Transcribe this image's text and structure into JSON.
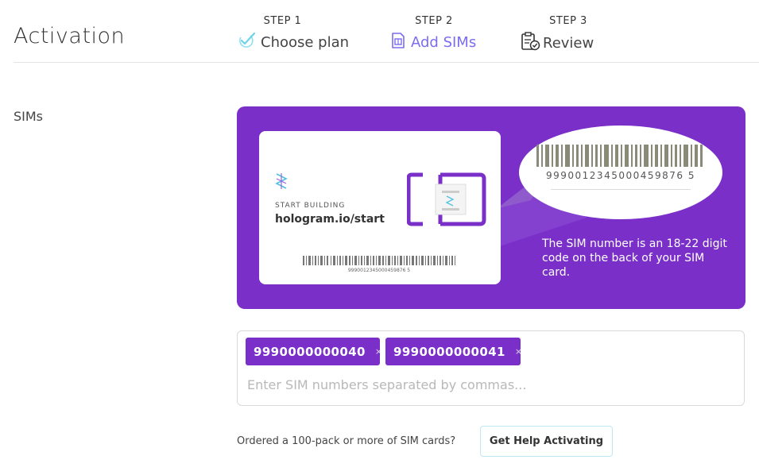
{
  "header": {
    "title": "Activation",
    "steps": [
      {
        "number": "STEP 1",
        "label": "Choose plan",
        "icon": "checkmark-icon",
        "state": "done"
      },
      {
        "number": "STEP 2",
        "label": "Add SIMs",
        "icon": "sim-card-icon",
        "state": "active"
      },
      {
        "number": "STEP 3",
        "label": "Review",
        "icon": "clipboard-check-icon",
        "state": "pending"
      }
    ]
  },
  "section": {
    "label": "SIMs"
  },
  "banner": {
    "card_small_text": "START BUILDING",
    "card_url": "hologram.io/start",
    "card_barcode_number": "9990012345000459876 5",
    "zoom_number": "9990012345000459876 5",
    "description": "The SIM number is an 18-22 digit code on the back of your SIM card.",
    "colors": {
      "background": "#7a2fc9",
      "accent": "#7b6cf0"
    }
  },
  "sim_input": {
    "tags": [
      {
        "value": "9990000000040",
        "remove": "×"
      },
      {
        "value": "9990000000041",
        "remove": "×"
      }
    ],
    "value": "",
    "placeholder": "Enter SIM numbers separated by commas..."
  },
  "footer": {
    "question": "Ordered a 100-pack or more of SIM cards?",
    "help_button": "Get Help Activating"
  }
}
